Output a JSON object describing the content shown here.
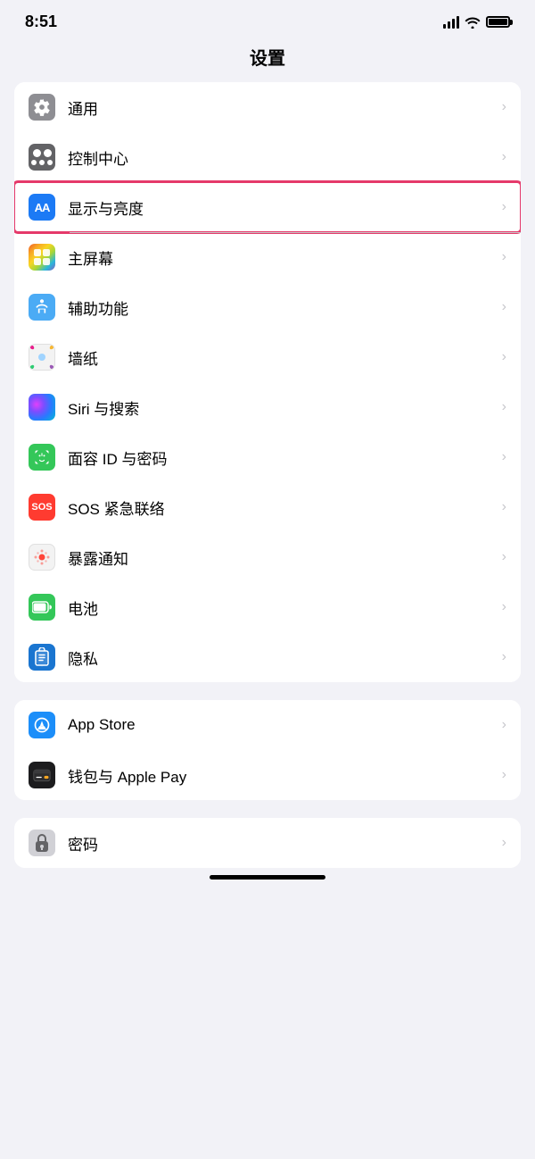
{
  "statusBar": {
    "time": "8:51",
    "signal": "signal-icon",
    "wifi": "wifi-icon",
    "battery": "battery-icon"
  },
  "pageTitle": "设置",
  "group1": {
    "items": [
      {
        "id": "tongyong",
        "label": "通用",
        "iconType": "gear",
        "iconBg": "gray",
        "highlighted": false
      },
      {
        "id": "kongzhizhongxin",
        "label": "控制中心",
        "iconType": "cc",
        "iconBg": "dark-gray",
        "highlighted": false
      },
      {
        "id": "xianshiylianid",
        "label": "显示与亮度",
        "iconType": "aa",
        "iconBg": "blue",
        "highlighted": true
      },
      {
        "id": "zhuping",
        "label": "主屏幕",
        "iconType": "colorful",
        "iconBg": "colorful",
        "highlighted": false
      },
      {
        "id": "fuzhu",
        "label": "辅助功能",
        "iconType": "accessibility",
        "iconBg": "light-blue",
        "highlighted": false
      },
      {
        "id": "bianzhi",
        "label": "墙纸",
        "iconType": "flower",
        "iconBg": "flower",
        "highlighted": false
      },
      {
        "id": "siri",
        "label": "Siri 与搜索",
        "iconType": "siri",
        "iconBg": "siri",
        "highlighted": false
      },
      {
        "id": "mianrong",
        "label": "面容 ID 与密码",
        "iconType": "faceid",
        "iconBg": "green",
        "highlighted": false
      },
      {
        "id": "sos",
        "label": "SOS 紧急联络",
        "iconType": "sos",
        "iconBg": "red",
        "highlighted": false
      },
      {
        "id": "baolu",
        "label": "暴露通知",
        "iconType": "exposure",
        "iconBg": "exposure",
        "highlighted": false
      },
      {
        "id": "dianchi",
        "label": "电池",
        "iconType": "battery",
        "iconBg": "battery-green",
        "highlighted": false
      },
      {
        "id": "yinsi",
        "label": "隐私",
        "iconType": "hand",
        "iconBg": "privacy-blue",
        "highlighted": false
      }
    ]
  },
  "group2": {
    "items": [
      {
        "id": "appstore",
        "label": "App Store",
        "iconType": "appstore",
        "iconBg": "appstore",
        "highlighted": false
      },
      {
        "id": "wallet",
        "label": "钱包与 Apple Pay",
        "iconType": "wallet",
        "iconBg": "wallet",
        "highlighted": false
      }
    ]
  },
  "group3": {
    "items": [
      {
        "id": "mima",
        "label": "密码",
        "iconType": "password",
        "iconBg": "password",
        "highlighted": false
      }
    ]
  },
  "chevron": "›"
}
